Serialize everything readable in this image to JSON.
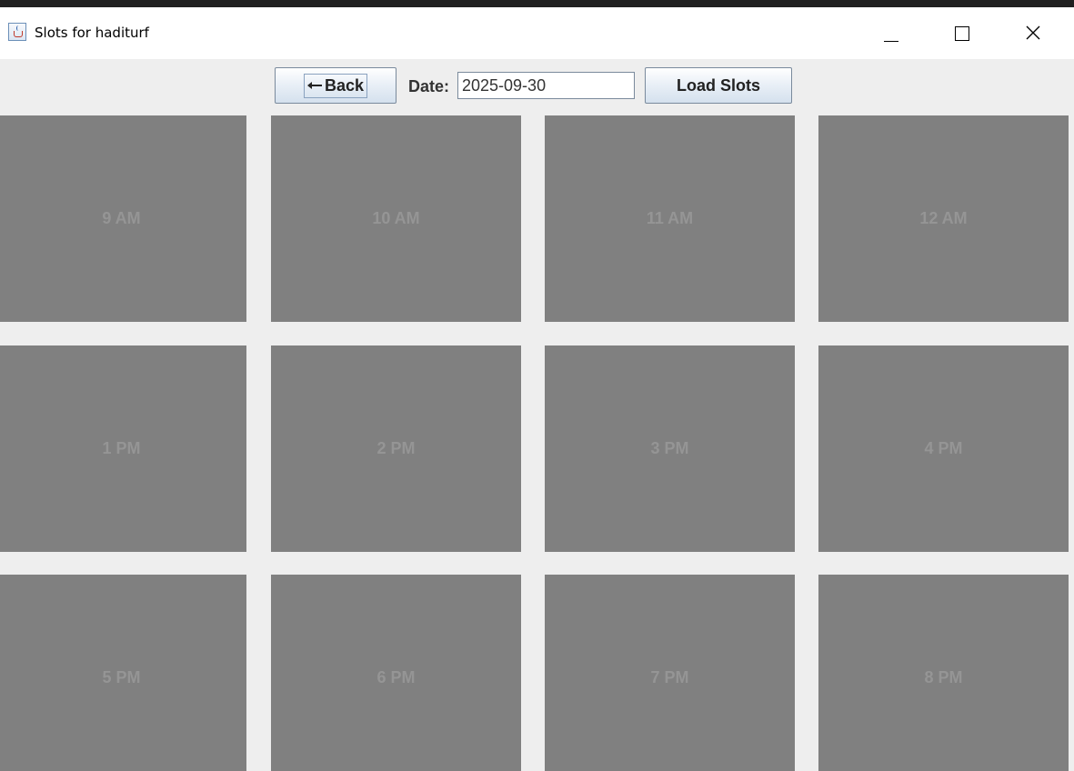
{
  "window": {
    "title": "Slots for haditurf"
  },
  "toolbar": {
    "back_label": "Back",
    "date_label": "Date:",
    "date_value": "2025-09-30",
    "load_label": "Load Slots"
  },
  "slots": [
    {
      "label": "9 AM"
    },
    {
      "label": "10 AM"
    },
    {
      "label": "11 AM"
    },
    {
      "label": "12 AM"
    },
    {
      "label": "1 PM"
    },
    {
      "label": "2 PM"
    },
    {
      "label": "3 PM"
    },
    {
      "label": "4 PM"
    },
    {
      "label": "5 PM"
    },
    {
      "label": "6 PM"
    },
    {
      "label": "7 PM"
    },
    {
      "label": "8 PM"
    }
  ],
  "colors": {
    "slot_background": "#808080",
    "slot_text": "#959595",
    "window_background": "#eeeeee"
  },
  "icons": {
    "app": "java-cup-icon",
    "back": "arrow-left-icon",
    "minimize": "minimize-icon",
    "maximize": "maximize-icon",
    "close": "close-icon"
  }
}
